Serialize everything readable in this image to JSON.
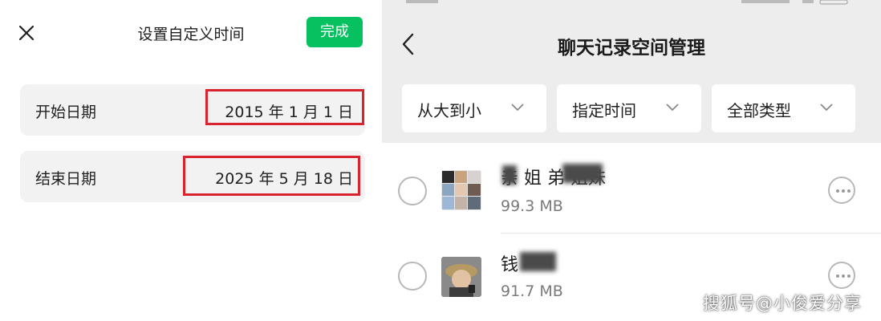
{
  "left_panel": {
    "title": "设置自定义时间",
    "close_icon": "close-icon",
    "done_label": "完成",
    "accent_color": "#07c160",
    "start": {
      "label": "开始日期",
      "value": "2015 年 1 月 1 日"
    },
    "end": {
      "label": "结束日期",
      "value": "2025 年 5 月 18 日"
    },
    "highlight_color": "#d9232e"
  },
  "right_panel": {
    "back_icon": "chevron-left-icon",
    "title": "聊天记录空间管理",
    "filters": [
      {
        "label": "从大到小",
        "icon": "chevron-down-icon"
      },
      {
        "label": "指定时间",
        "icon": "chevron-down-icon"
      },
      {
        "label": "全部类型",
        "icon": "chevron-down-icon"
      }
    ],
    "items": [
      {
        "name": "亲  姐  弟  姐妹",
        "size": "99.3 MB",
        "more_icon": "more-icon"
      },
      {
        "name": "钱  ",
        "size": "91.7 MB",
        "more_icon": "more-icon"
      }
    ]
  },
  "watermark": "搜狐号@小俊爱分享"
}
